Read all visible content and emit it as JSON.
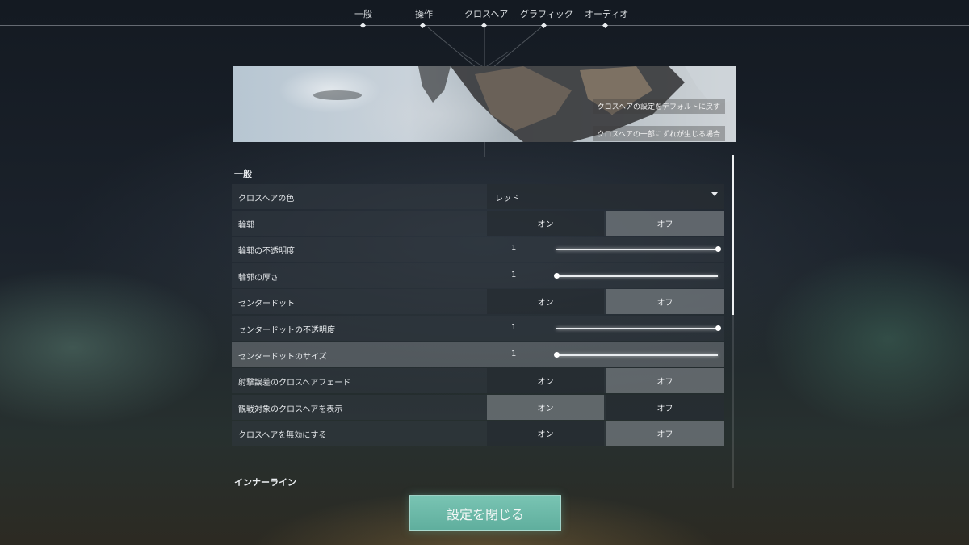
{
  "nav": {
    "tabs": [
      {
        "label": "一般"
      },
      {
        "label": "操作"
      },
      {
        "label": "クロスヘア"
      },
      {
        "label": "グラフィック"
      },
      {
        "label": "オーディオ"
      }
    ],
    "active_index": 2
  },
  "banner": {
    "reset_link": "クロスヘアの設定をデフォルトに戻す",
    "misaligned_link": "クロスヘアの一部にずれが生じる場合"
  },
  "general": {
    "title": "一般",
    "crosshair_color": {
      "label": "クロスヘアの色",
      "value": "レッド"
    },
    "outlines": {
      "label": "輪郭",
      "on": "オン",
      "off": "オフ",
      "selected": "off"
    },
    "outline_opacity": {
      "label": "輪郭の不透明度",
      "value": "1",
      "fraction": 1.0
    },
    "outline_thickness": {
      "label": "輪郭の厚さ",
      "value": "1",
      "fraction": 0.0
    },
    "center_dot": {
      "label": "センタードット",
      "on": "オン",
      "off": "オフ",
      "selected": "off"
    },
    "center_dot_opacity": {
      "label": "センタードットの不透明度",
      "value": "1",
      "fraction": 1.0
    },
    "center_dot_size": {
      "label": "センタードットのサイズ",
      "value": "1",
      "fraction": 0.0
    },
    "fade_with_firing_error": {
      "label": "射撃誤差のクロスヘアフェード",
      "on": "オン",
      "off": "オフ",
      "selected": "off"
    },
    "show_spectated_crosshair": {
      "label": "観戦対象のクロスヘアを表示",
      "on": "オン",
      "off": "オフ",
      "selected": "on"
    },
    "disable_crosshair": {
      "label": "クロスヘアを無効にする",
      "on": "オン",
      "off": "オフ",
      "selected": "off"
    }
  },
  "inner_lines": {
    "title": "インナーライン"
  },
  "footer": {
    "close_label": "設定を閉じる"
  },
  "colors": {
    "accent": "#6dbaa8",
    "text": "#e9ecef"
  }
}
